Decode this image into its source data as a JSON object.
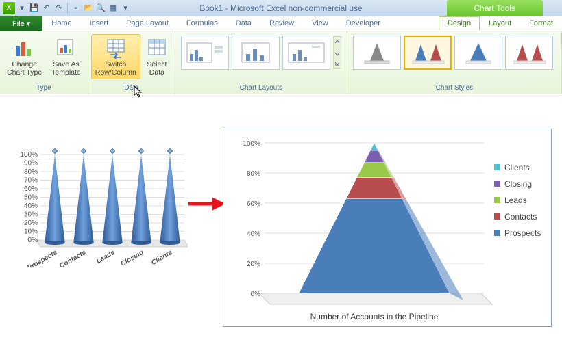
{
  "title": "Book1 - Microsoft Excel non-commercial use",
  "context_tab": "Chart Tools",
  "file_tab": "File",
  "tabs": [
    "Home",
    "Insert",
    "Page Layout",
    "Formulas",
    "Data",
    "Review",
    "View",
    "Developer"
  ],
  "ctx_tabs": [
    "Design",
    "Layout",
    "Format"
  ],
  "ribbon": {
    "type": {
      "label": "Type",
      "change": "Change\nChart Type",
      "save": "Save As\nTemplate"
    },
    "data": {
      "label": "Data",
      "switch": "Switch\nRow/Column",
      "select": "Select\nData"
    },
    "layouts": {
      "label": "Chart Layouts"
    },
    "styles": {
      "label": "Chart Styles"
    }
  },
  "chart_data": [
    {
      "type": "bar",
      "note": "left chart — five 100%-stacked cones, one per category",
      "categories": [
        "Prospects",
        "Contacts",
        "Leads",
        "Closing",
        "Clients"
      ],
      "y_ticks": [
        "0%",
        "10%",
        "20%",
        "30%",
        "40%",
        "50%",
        "60%",
        "70%",
        "80%",
        "90%",
        "100%"
      ],
      "values": [
        100,
        100,
        100,
        100,
        100
      ]
    },
    {
      "type": "bar",
      "note": "right chart — single 100%-stacked pyramid after Switch Row/Column",
      "title": "Number of Accounts in the Pipeline",
      "y_ticks": [
        "0%",
        "20%",
        "40%",
        "60%",
        "80%",
        "100%"
      ],
      "series": [
        {
          "name": "Prospects",
          "pct": 63,
          "color": "#4a7ebb"
        },
        {
          "name": "Contacts",
          "pct": 14,
          "color": "#b84d4d"
        },
        {
          "name": "Leads",
          "pct": 10,
          "color": "#9ac94a"
        },
        {
          "name": "Closing",
          "pct": 8,
          "color": "#7a5fb0"
        },
        {
          "name": "Clients",
          "pct": 5,
          "color": "#4fc0cf"
        }
      ],
      "legend": [
        "Clients",
        "Closing",
        "Leads",
        "Contacts",
        "Prospects"
      ]
    }
  ]
}
